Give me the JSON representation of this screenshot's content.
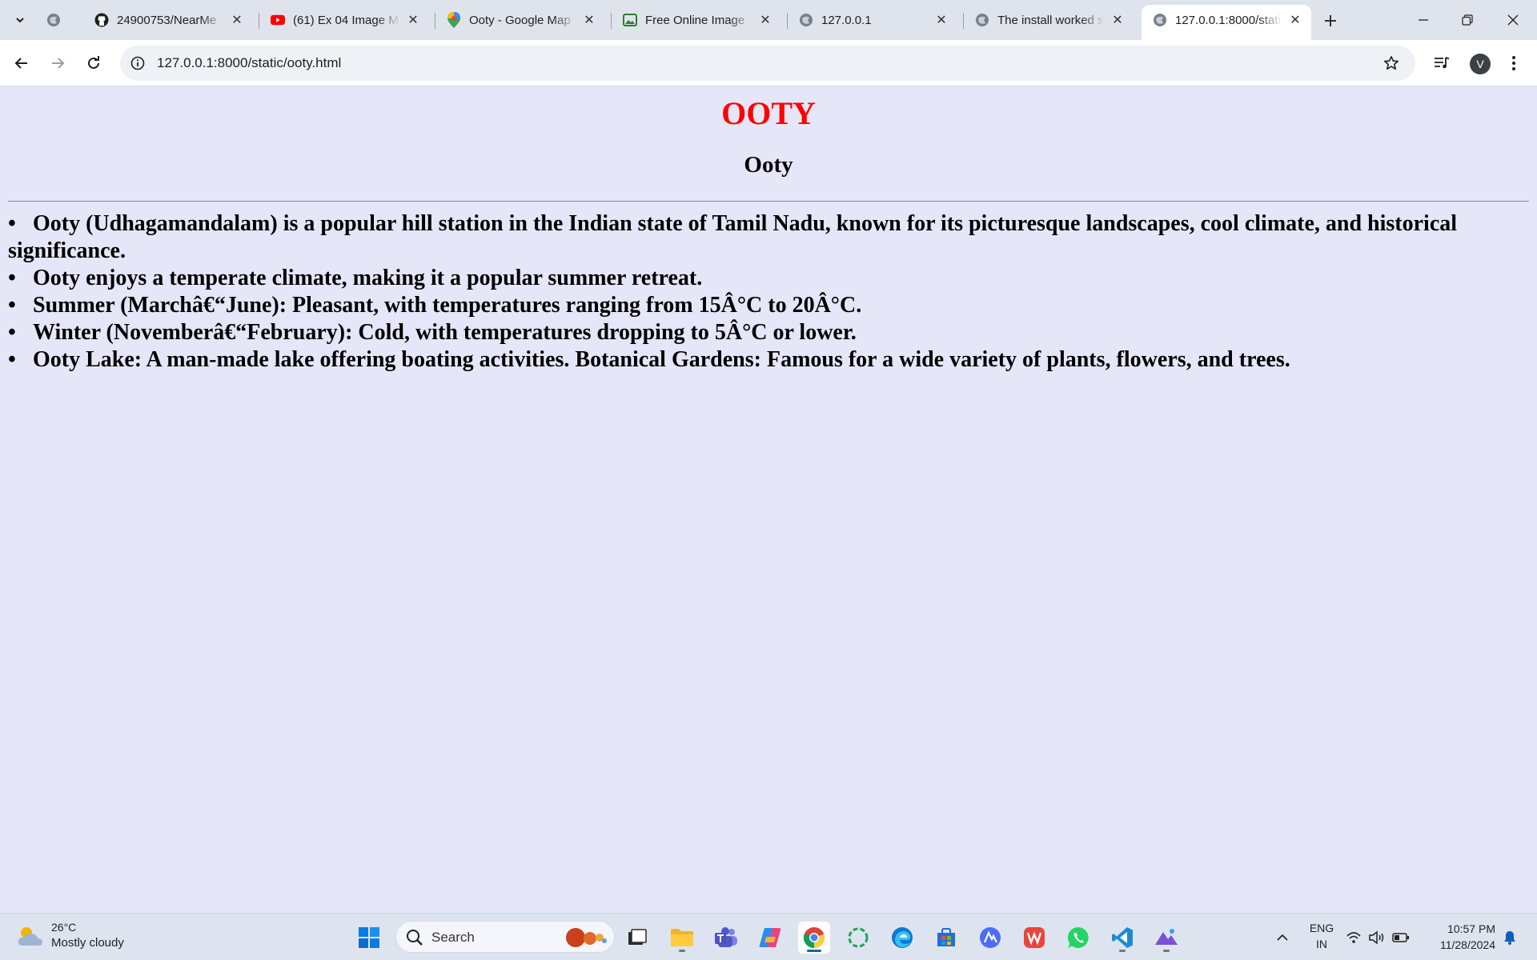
{
  "browser": {
    "tabs": [
      {
        "title": "",
        "favicon": "globe-icon"
      },
      {
        "title": "24900753/NearMe",
        "favicon": "github-icon"
      },
      {
        "title": "(61) Ex 04 Image M",
        "favicon": "youtube-icon"
      },
      {
        "title": "Ooty - Google Map",
        "favicon": "google-maps-icon"
      },
      {
        "title": "Free Online Image",
        "favicon": "image-icon"
      },
      {
        "title": "127.0.0.1",
        "favicon": "globe-icon"
      },
      {
        "title": "The install worked s",
        "favicon": "globe-icon"
      },
      {
        "title": "127.0.0.1:8000/stati",
        "favicon": "globe-icon",
        "active": true
      }
    ],
    "url": "127.0.0.1:8000/static/ooty.html",
    "profile_initial": "V"
  },
  "page": {
    "title": "OOTY",
    "title_color": "#ff0000",
    "subtitle": "Ooty",
    "bullet": "•",
    "items": [
      "Ooty (Udhagamandalam) is a popular hill station in the Indian state of Tamil Nadu, known for its picturesque landscapes, cool climate, and historical significance.",
      "Ooty enjoys a temperate climate, making it a popular summer retreat.",
      "Summer (Marchâ€“June): Pleasant, with temperatures ranging from 15Â°C to 20Â°C.",
      "Winter (Novemberâ€“February): Cold, with temperatures dropping to 5Â°C or lower.",
      "Ooty Lake: A man-made lake offering boating activities. Botanical Gardens: Famous for a wide variety of plants, flowers, and trees."
    ],
    "background": "#e6e6f9"
  },
  "taskbar": {
    "weather_temp": "26°C",
    "weather_desc": "Mostly cloudy",
    "search_placeholder": "Search",
    "lang_top": "ENG",
    "lang_bottom": "IN",
    "time": "10:57 PM",
    "date": "11/28/2024"
  }
}
